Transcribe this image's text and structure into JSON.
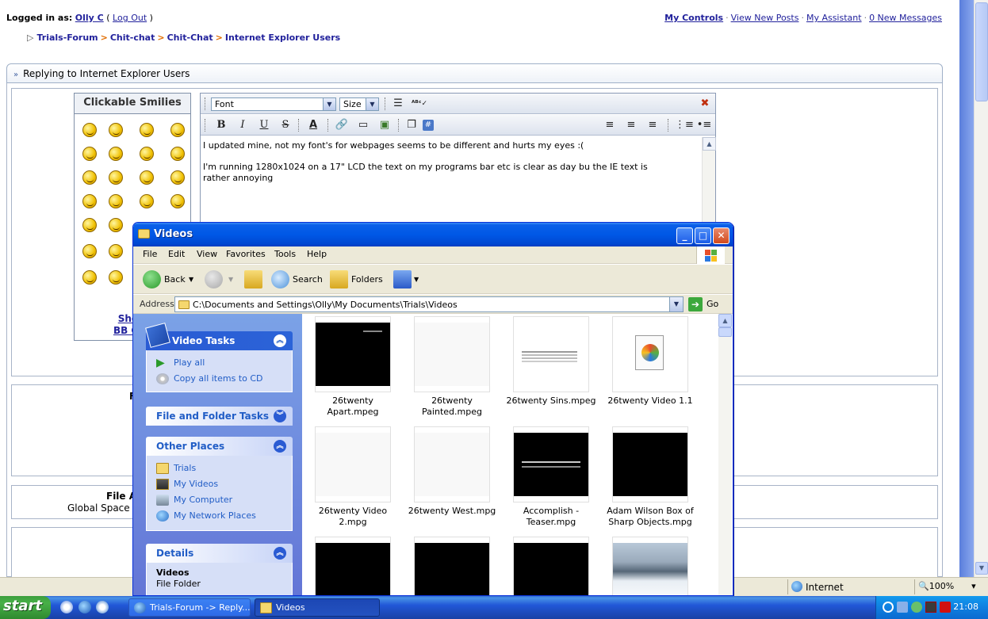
{
  "forum": {
    "login": {
      "prefix": "Logged in as:",
      "user": "Olly C",
      "logout": "Log Out",
      "open": "(",
      "close": ")"
    },
    "controls": [
      "My Controls",
      "View New Posts",
      "My Assistant",
      "0 New Messages"
    ],
    "breadcrumb": [
      "Trials-Forum",
      "Chit-chat",
      "Chit-Chat",
      "Internet Explorer Users"
    ],
    "reply_title": "Replying to Internet Explorer Users",
    "smilies_title": "Clickable Smilies",
    "show_link_partial": "Show",
    "bbcode_link_partial": "BB Cod",
    "section2_partial": "F",
    "file_attach_partial": "File A",
    "global_space_partial": "Global Space L",
    "editor": {
      "font_label": "Font",
      "size_label": "Size",
      "text": "I updated mine, not my font's for webpages seems to be different and hurts my eyes :(\n\nI'm running 1280x1024 on a 17\" LCD the text on my programs bar etc is clear as day bu the IE text is\nrather annoying",
      "bold": "B",
      "italic": "I",
      "underline": "U",
      "strike": "S",
      "color": "A",
      "close": "✖"
    },
    "statusbar": {
      "zone": "Internet",
      "zoom": "100%"
    }
  },
  "explorer": {
    "title": "Videos",
    "menu": [
      "File",
      "Edit",
      "View",
      "Favorites",
      "Tools",
      "Help"
    ],
    "toolbar": {
      "back": "Back",
      "search": "Search",
      "folders": "Folders"
    },
    "address_label": "Address",
    "address": "C:\\Documents and Settings\\Olly\\My Documents\\Trials\\Videos",
    "go": "Go",
    "tasks": {
      "video_tasks": "Video Tasks",
      "play_all": "Play all",
      "copy_cd": "Copy all items to CD",
      "file_folder_tasks": "File and Folder Tasks",
      "other_places": "Other Places",
      "places": [
        "Trials",
        "My Videos",
        "My Computer",
        "My Network Places"
      ],
      "details": "Details",
      "details_name": "Videos",
      "details_type": "File Folder"
    },
    "files": [
      {
        "name": "26twenty Apart.mpeg",
        "thumb": "dark"
      },
      {
        "name": "26twenty Painted.mpeg",
        "thumb": "blank"
      },
      {
        "name": "26twenty Sins.mpeg",
        "thumb": "text"
      },
      {
        "name": "26twenty Video 1.1",
        "thumb": "mediaicon"
      },
      {
        "name": "26twenty Video 2.mpg",
        "thumb": "blank"
      },
      {
        "name": "26twenty West.mpg",
        "thumb": "blank"
      },
      {
        "name": "Accomplish - Teaser.mpg",
        "thumb": "darktext"
      },
      {
        "name": "Adam Wilson Box of Sharp Objects.mpg",
        "thumb": "dark"
      },
      {
        "name": "",
        "thumb": "dark"
      },
      {
        "name": "",
        "thumb": "dark"
      },
      {
        "name": "",
        "thumb": "dark"
      },
      {
        "name": "",
        "thumb": "snow"
      }
    ]
  },
  "taskbar": {
    "start": "start",
    "tasks": [
      "Trials-Forum -> Reply...",
      "Videos"
    ],
    "clock": "21:08"
  }
}
